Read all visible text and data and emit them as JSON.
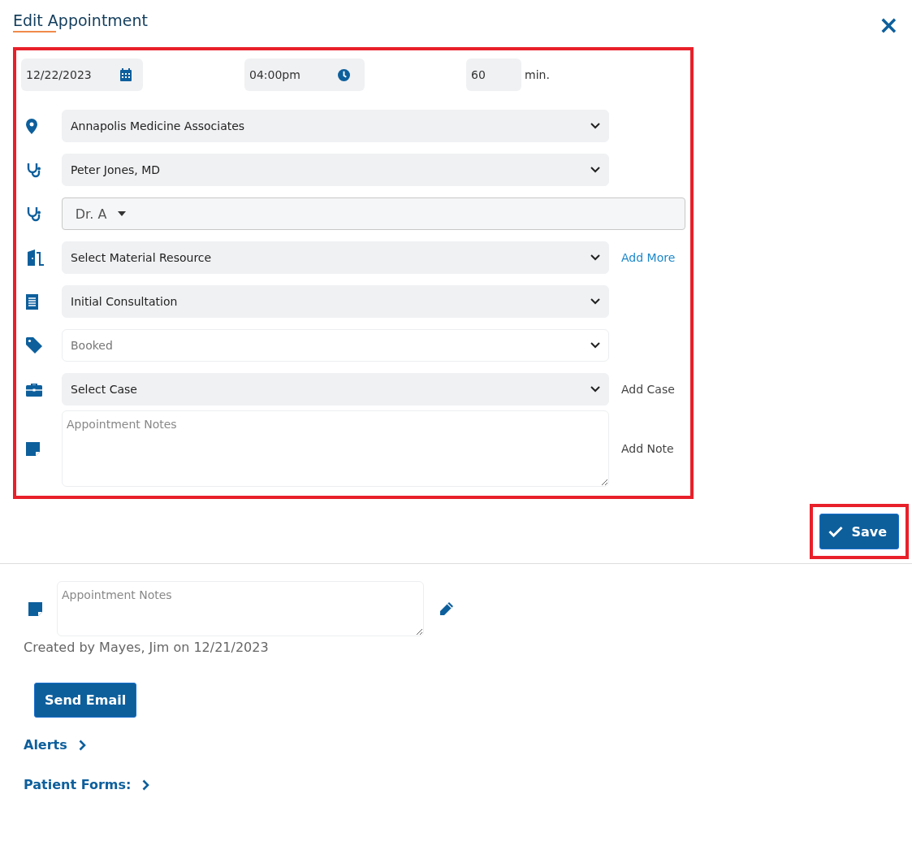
{
  "dialog": {
    "title": "Edit Appointment",
    "close_icon": "×"
  },
  "schedule": {
    "date": "12/22/2023",
    "time": "04:00pm",
    "duration": "60",
    "duration_unit": "min."
  },
  "fields": [
    {
      "kind": "select",
      "value": "Annapolis Medicine Associates",
      "disabled": false
    },
    {
      "kind": "select",
      "value": "Peter Jones, MD",
      "disabled": false
    },
    {
      "kind": "dropdown",
      "value": "Dr. A",
      "disabled": false
    },
    {
      "kind": "select",
      "value": "Select Material Resource",
      "disabled": false,
      "action": {
        "label": "Add More",
        "kind": "link"
      }
    },
    {
      "kind": "select",
      "value": "Initial Consultation",
      "disabled": false
    },
    {
      "kind": "select",
      "value": "Booked",
      "disabled": true
    },
    {
      "kind": "select",
      "value": "Select Case",
      "disabled": false,
      "action": {
        "label": "Add Case",
        "kind": "text"
      }
    },
    {
      "kind": "textarea",
      "placeholder": "Appointment Notes",
      "action": {
        "label": "Add Note",
        "kind": "text"
      }
    }
  ],
  "save_button": "Save",
  "notes": {
    "placeholder": "Appointment Notes",
    "created": "Created by Mayes, Jim on 12/21/2023"
  },
  "send_email_button": "Send Email",
  "sections": [
    {
      "label": "Alerts"
    },
    {
      "label": "Patient Forms:"
    }
  ]
}
